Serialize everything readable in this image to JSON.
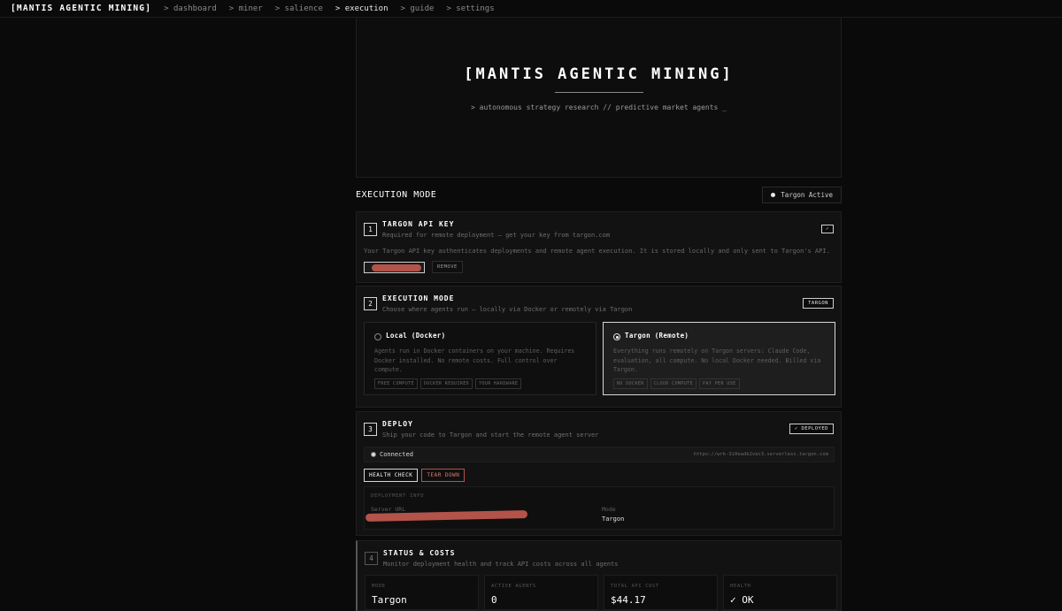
{
  "nav": {
    "brand": "[MANTIS AGENTIC MINING]",
    "items": [
      "> dashboard",
      "> miner",
      "> salience",
      "> execution",
      "> guide",
      "> settings"
    ]
  },
  "hero": {
    "title": "[MANTIS AGENTIC MINING]",
    "subtitle": "> autonomous strategy research // predictive market agents _"
  },
  "section": {
    "title": "EXECUTION MODE",
    "status": "Targon Active"
  },
  "step1": {
    "num": "1",
    "title": "TARGON API KEY",
    "subtitle": "Required for remote deployment — get your key from targon.com",
    "badge": "✓",
    "description": "Your Targon API key authenticates deployments and remote agent execution. It is stored locally and only sent to Targon's API.",
    "remove": "REMOVE"
  },
  "step2": {
    "num": "2",
    "title": "EXECUTION MODE",
    "subtitle": "Choose where agents run — locally via Docker or remotely via Targon",
    "badge": "TARGON",
    "options": [
      {
        "title": "Local (Docker)",
        "desc": "Agents run in Docker containers on your machine. Requires Docker installed. No remote costs. Full control over compute.",
        "tags": [
          "FREE COMPUTE",
          "DOCKER REQUIRED",
          "YOUR HARDWARE"
        ]
      },
      {
        "title": "Targon (Remote)",
        "desc": "Everything runs remotely on Targon servers: Claude Code, evaluation, all compute. No local Docker needed. Billed via Targon.",
        "tags": [
          "NO DOCKER",
          "CLOUD COMPUTE",
          "PAY PER USE"
        ]
      }
    ]
  },
  "step3": {
    "num": "3",
    "title": "DEPLOY",
    "subtitle": "Ship your code to Targon and start the remote agent server",
    "badge": "✓ DEPLOYED",
    "status": "Connected",
    "url": "https://wrk-3i0eadk2vec3.serverless.targon.com",
    "health_check": "HEALTH CHECK",
    "tear_down": "TEAR DOWN",
    "info": {
      "header": "DEPLOYMENT INFO",
      "server_label": "Server URL",
      "mode_label": "Mode",
      "mode_value": "Targon"
    }
  },
  "step4": {
    "num": "4",
    "title": "STATUS & COSTS",
    "subtitle": "Monitor deployment health and track API costs across all agents",
    "metrics": [
      {
        "label": "MODE",
        "value": "Targon"
      },
      {
        "label": "ACTIVE AGENTS",
        "value": "0"
      },
      {
        "label": "TOTAL API COST",
        "value": "$44.17"
      },
      {
        "label": "HEALTH",
        "value": "✓ OK"
      }
    ]
  },
  "colors": {
    "background": "#0a0a0a",
    "card": "#121212",
    "accent": "#ffffff",
    "danger": "#b3534a",
    "redaction": "#b3534a"
  }
}
